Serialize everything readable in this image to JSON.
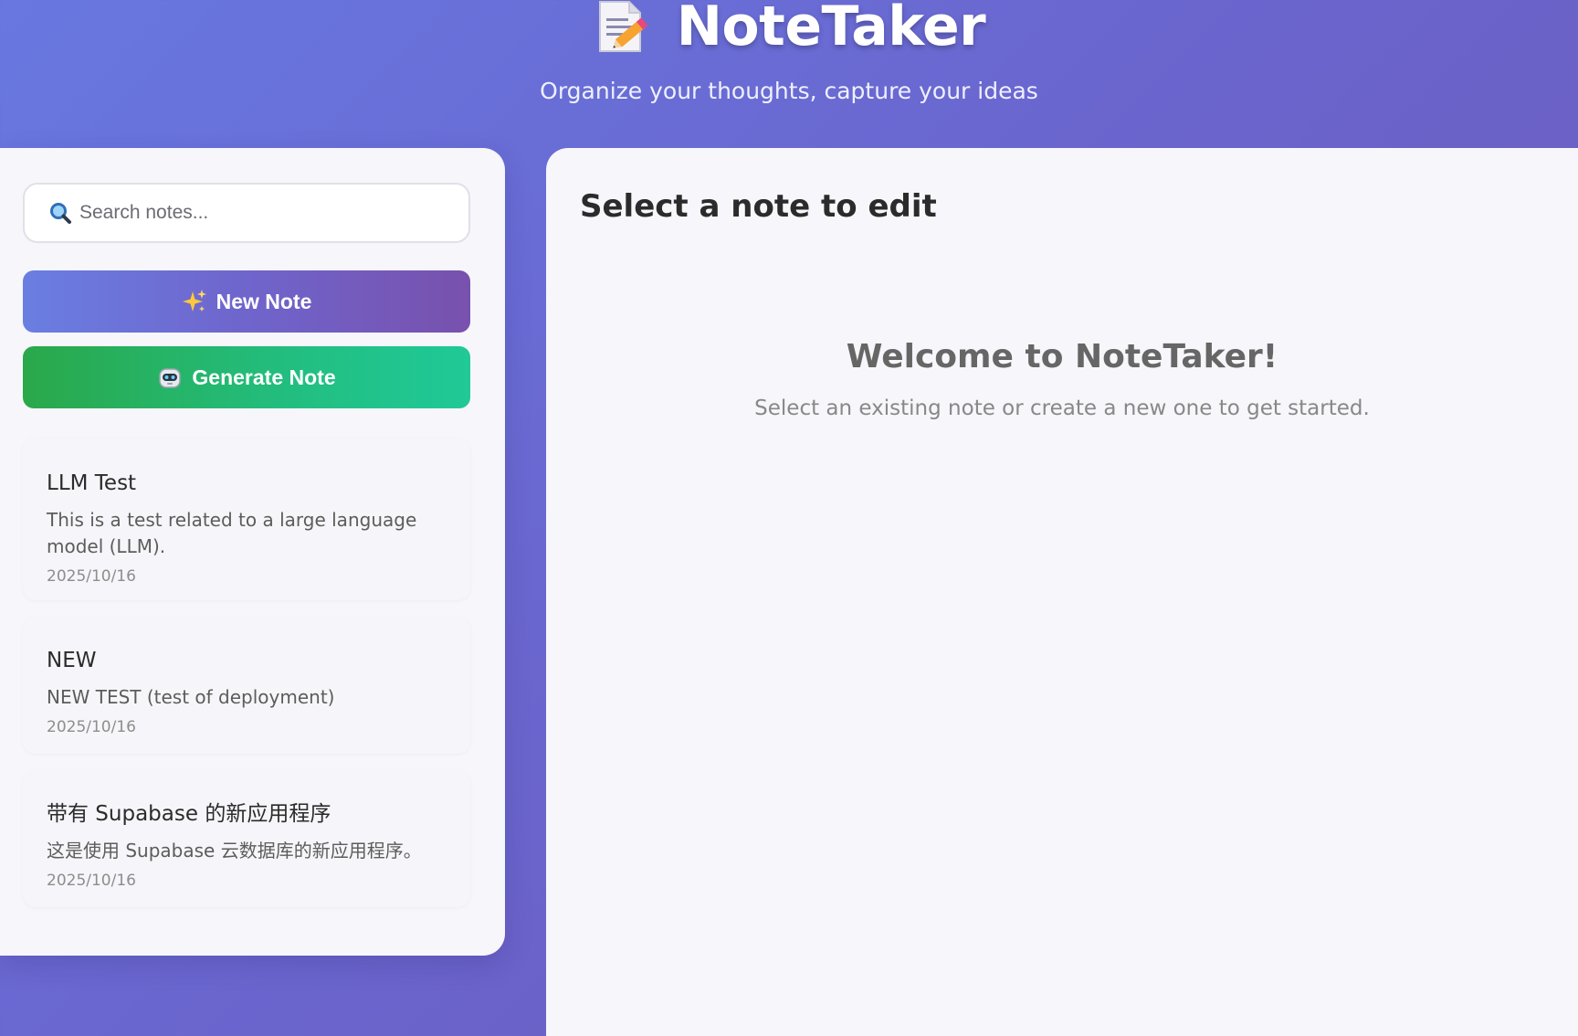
{
  "header": {
    "app_title": "NoteTaker",
    "subtitle": "Organize your thoughts, capture your ideas",
    "logo_icon": "memo-pencil-icon"
  },
  "sidebar": {
    "search": {
      "placeholder": "Search notes...",
      "value": "",
      "icon": "magnifying-glass-icon"
    },
    "new_note_button": {
      "label": "New Note",
      "icon": "sparkles-icon"
    },
    "generate_note_button": {
      "label": "Generate Note",
      "icon": "robot-icon"
    },
    "notes": [
      {
        "title": "LLM Test",
        "preview": "This is a test related to a large language model (LLM).",
        "date": "2025/10/16"
      },
      {
        "title": "NEW",
        "preview": "NEW TEST (test of deployment)",
        "date": "2025/10/16"
      },
      {
        "title": "带有 Supabase 的新应用程序",
        "preview": "这是使用 Supabase 云数据库的新应用程序。",
        "date": "2025/10/16"
      }
    ]
  },
  "main": {
    "title": "Select a note to edit",
    "welcome_title": "Welcome to NoteTaker!",
    "welcome_text": "Select an existing note or create a new one to get started."
  },
  "colors": {
    "background_start": "#6878e0",
    "background_end": "#6d58b7",
    "primary_button": "#6f65cc",
    "generate_button": "#22be80"
  }
}
